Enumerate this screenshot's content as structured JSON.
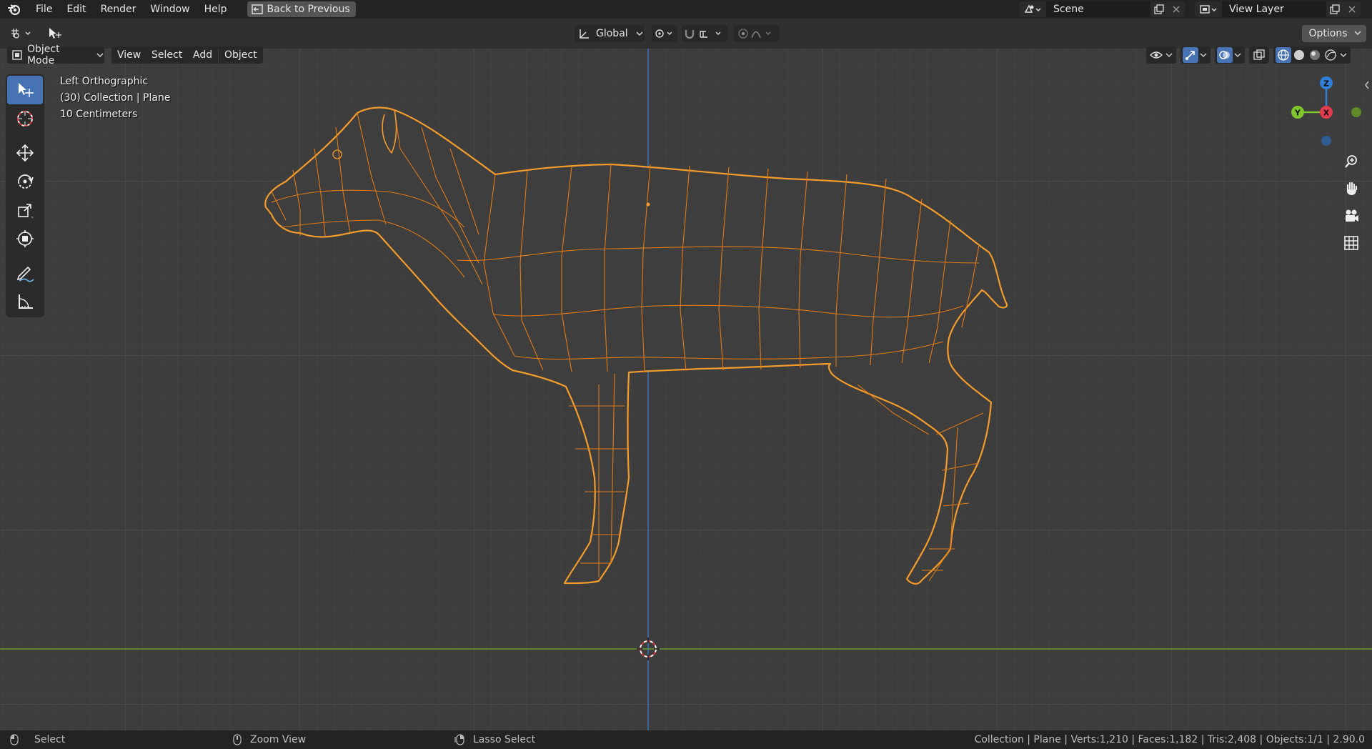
{
  "menubar": {
    "items": [
      "File",
      "Edit",
      "Render",
      "Window",
      "Help"
    ],
    "back_button": "Back to Previous",
    "scene": "Scene",
    "view_layer": "View Layer"
  },
  "tool_header": {
    "transform_orientation": "Global",
    "options": "Options"
  },
  "viewport_header": {
    "mode": "Object Mode",
    "menus": [
      "View",
      "Select",
      "Add",
      "Object"
    ]
  },
  "overlay": {
    "view_name": "Left Orthographic",
    "collection": "(30) Collection | Plane",
    "scale": "10 Centimeters"
  },
  "gizmo": {
    "z": "Z",
    "y": "Y",
    "x": "X"
  },
  "statusbar": {
    "hint_1": "Select",
    "hint_2": "Zoom View",
    "hint_3": "Lasso Select",
    "stats": "Collection | Plane | Verts:1,210 | Faces:1,182 | Tris:2,408 | Objects:1/1 | 2.90.0"
  },
  "colors": {
    "selection_outline": "#f39c2b",
    "wire": "#e07a15",
    "axis_y_line": "#6b9b30",
    "axis_z_line": "#3a76c4",
    "active_tool": "#4772b3"
  }
}
